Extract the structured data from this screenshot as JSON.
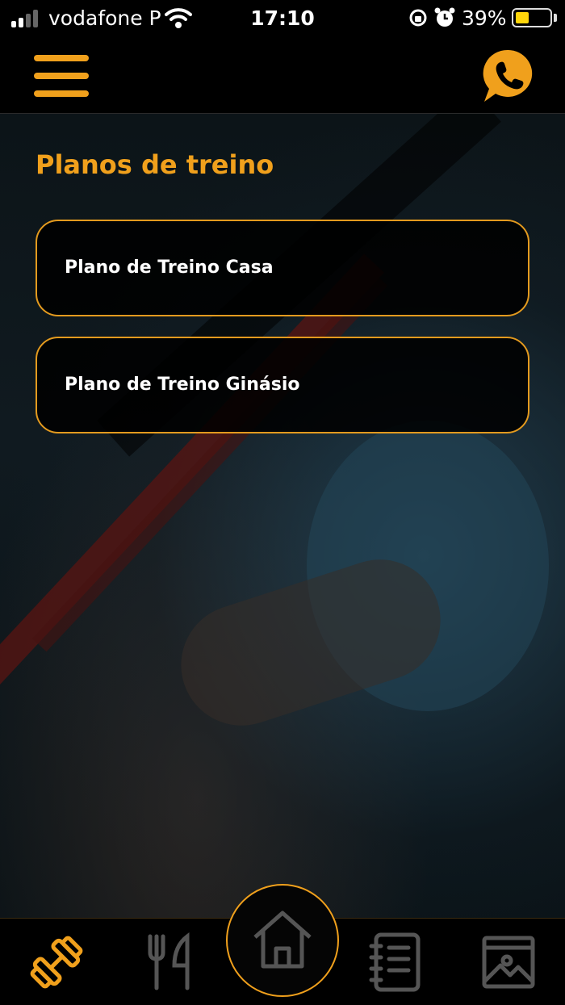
{
  "status_bar": {
    "carrier": "vodafone P",
    "time": "17:10",
    "battery_percent": "39%",
    "battery_level": 0.39
  },
  "header": {
    "menu_icon": "hamburger-menu-icon",
    "contact_icon": "phone-chat-icon"
  },
  "main": {
    "title": "Planos de treino",
    "plans": [
      {
        "label": "Plano de Treino Casa"
      },
      {
        "label": "Plano de Treino Ginásio"
      }
    ]
  },
  "bottom_nav": {
    "items": [
      {
        "icon": "dumbbell-icon",
        "active": true
      },
      {
        "icon": "fork-knife-icon",
        "active": false
      },
      {
        "icon": "home-icon",
        "active": false
      },
      {
        "icon": "notebook-list-icon",
        "active": false
      },
      {
        "icon": "image-gallery-icon",
        "active": false
      }
    ]
  },
  "colors": {
    "accent": "#f0a01c",
    "background": "#000000",
    "inactive_icon": "#555555"
  }
}
